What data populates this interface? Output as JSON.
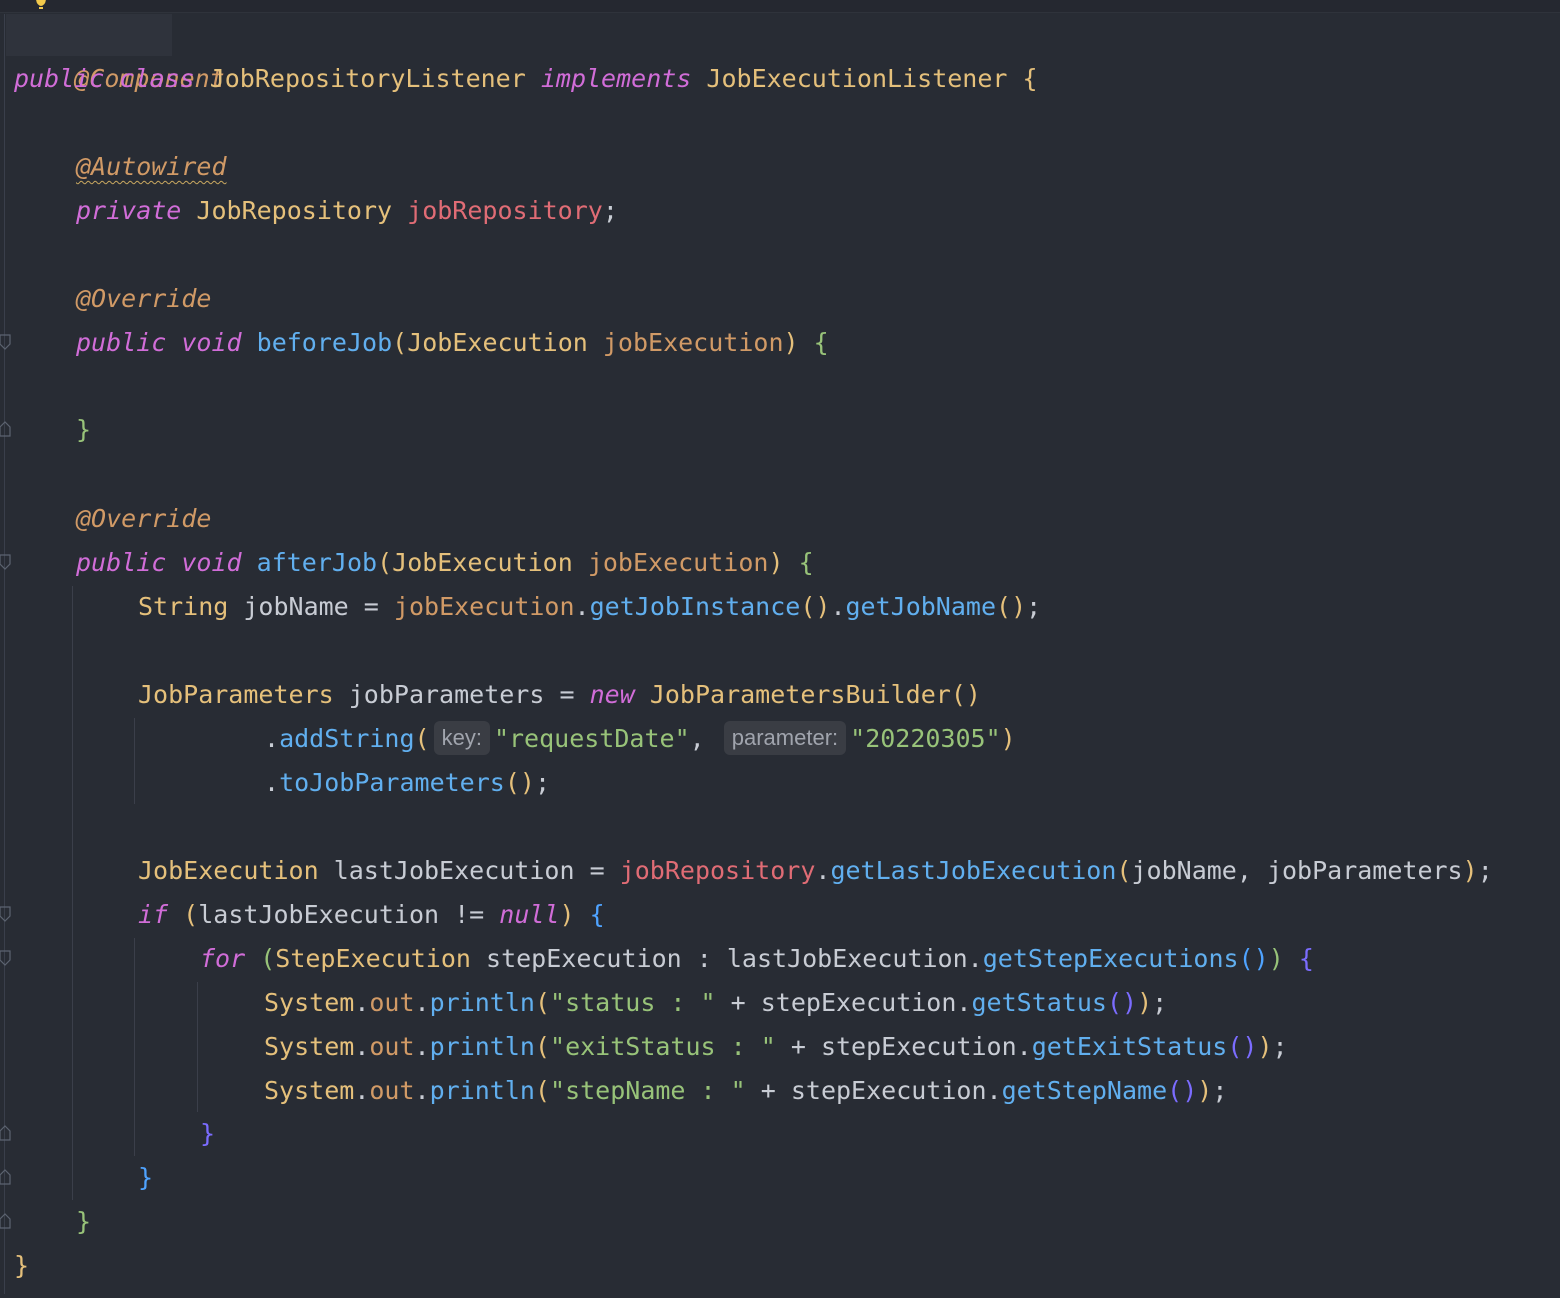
{
  "code": {
    "l1": {
      "annotation": "@Component"
    },
    "l2": {
      "kw_public": "public",
      "kw_class": "class",
      "class_name": "JobRepositoryListener",
      "kw_implements": "implements",
      "interface_name": "JobExecutionListener",
      "open": "{"
    },
    "l4": {
      "annotation": "@Autowired"
    },
    "l5": {
      "kw_private": "private",
      "type": "JobRepository",
      "field": "jobRepository",
      "semi": ";"
    },
    "l7": {
      "annotation": "@Override"
    },
    "l8": {
      "kw_public": "public",
      "kw_void": "void",
      "method": "beforeJob",
      "lparen": "(",
      "ptype": "JobExecution",
      "pname": "jobExecution",
      "rparen": ")",
      "open": "{"
    },
    "l10": {
      "close": "}"
    },
    "l12": {
      "annotation": "@Override"
    },
    "l13": {
      "kw_public": "public",
      "kw_void": "void",
      "method": "afterJob",
      "lparen": "(",
      "ptype": "JobExecution",
      "pname": "jobExecution",
      "rparen": ")",
      "open": "{"
    },
    "l14": {
      "type": "String",
      "var": "jobName",
      "eq": "=",
      "recv": "jobExecution",
      "dot1": ".",
      "m1": "getJobInstance",
      "p1": "()",
      "dot2": ".",
      "m2": "getJobName",
      "p2": "()",
      "semi": ";"
    },
    "l16": {
      "type": "JobParameters",
      "var": "jobParameters",
      "eq": "=",
      "kw_new": "new",
      "ctor": "JobParametersBuilder",
      "parens": "()"
    },
    "l17": {
      "dot": ".",
      "method": "addString",
      "lparen": "(",
      "hint_key": "key:",
      "arg1": "\"requestDate\"",
      "comma": ",",
      "hint_param": "parameter:",
      "arg2": "\"20220305\"",
      "rparen": ")"
    },
    "l18": {
      "dot": ".",
      "method": "toJobParameters",
      "parens": "()",
      "semi": ";"
    },
    "l20": {
      "type": "JobExecution",
      "var": "lastJobExecution",
      "eq": "=",
      "recv": "jobRepository",
      "dot": ".",
      "method": "getLastJobExecution",
      "lparen": "(",
      "args": "jobName, jobParameters",
      "rparen": ")",
      "semi": ";"
    },
    "l21": {
      "kw_if": "if",
      "lparen": "(",
      "cond": "lastJobExecution != ",
      "kw_null": "null",
      "rparen": ")",
      "open": "{"
    },
    "l22": {
      "kw_for": "for",
      "lparen": "(",
      "type": "StepExecution",
      "rest": "stepExecution : lastJobExecution",
      "dot": ".",
      "method": "getStepExecutions",
      "parens": "()",
      "rparen": ")",
      "open": "{"
    },
    "l23": {
      "sys": "System",
      "dot1": ".",
      "out": "out",
      "dot2": ".",
      "println": "println",
      "lparen": "(",
      "str": "\"status : \"",
      "plus": " + stepExecution",
      "dot3": ".",
      "method": "getStatus",
      "parens": "()",
      "rparen": ")",
      "semi": ";"
    },
    "l24": {
      "sys": "System",
      "dot1": ".",
      "out": "out",
      "dot2": ".",
      "println": "println",
      "lparen": "(",
      "str": "\"exitStatus : \"",
      "plus": " + stepExecution",
      "dot3": ".",
      "method": "getExitStatus",
      "parens": "()",
      "rparen": ")",
      "semi": ";"
    },
    "l25": {
      "sys": "System",
      "dot1": ".",
      "out": "out",
      "dot2": ".",
      "println": "println",
      "lparen": "(",
      "str": "\"stepName : \"",
      "plus": " + stepExecution",
      "dot3": ".",
      "method": "getStepName",
      "parens": "()",
      "rparen": ")",
      "semi": ";"
    },
    "l26": {
      "close": "}"
    },
    "l27": {
      "close": "}"
    },
    "l28": {
      "close": "}"
    },
    "l29": {
      "close": "}"
    }
  },
  "colors": {
    "background": "#282c34",
    "keyword": "#d16dd8",
    "annotation": "#d19a66",
    "class": "#e5c07b",
    "method": "#61afef",
    "field": "#e06c75",
    "string": "#98c379"
  },
  "icons": {
    "bulb": "lightbulb-icon"
  }
}
